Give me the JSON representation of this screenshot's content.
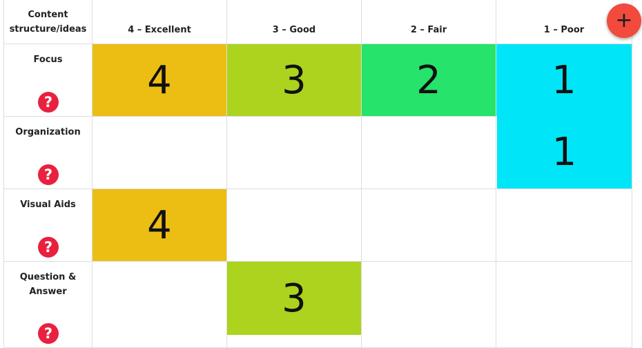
{
  "header": {
    "corner_label": "Content structure/ideas",
    "columns": [
      "4 – Excellent",
      "3 – Good",
      "2 – Fair",
      "1 – Poor"
    ]
  },
  "rows": [
    {
      "label": "Focus",
      "help_icon": "question-circle-icon"
    },
    {
      "label": "Organization",
      "help_icon": "question-circle-icon"
    },
    {
      "label": "Visual Aids",
      "help_icon": "question-circle-icon"
    },
    {
      "label": "Question & Answer",
      "help_icon": "question-circle-icon"
    }
  ],
  "scores": {
    "focus_excellent": "4",
    "focus_good": "3",
    "focus_fair": "2",
    "focus_poor": "1",
    "organization_poor": "1",
    "visual_aids_excellent": "4",
    "qa_good": "3"
  },
  "colors": {
    "excellent": "#ecbe13",
    "good": "#acd31d",
    "fair": "#25e36b",
    "poor": "#00e5f7",
    "help_icon": "#e8213f",
    "fab": "#f24a3c"
  },
  "fab": {
    "symbol": "+",
    "icon": "plus-icon"
  }
}
